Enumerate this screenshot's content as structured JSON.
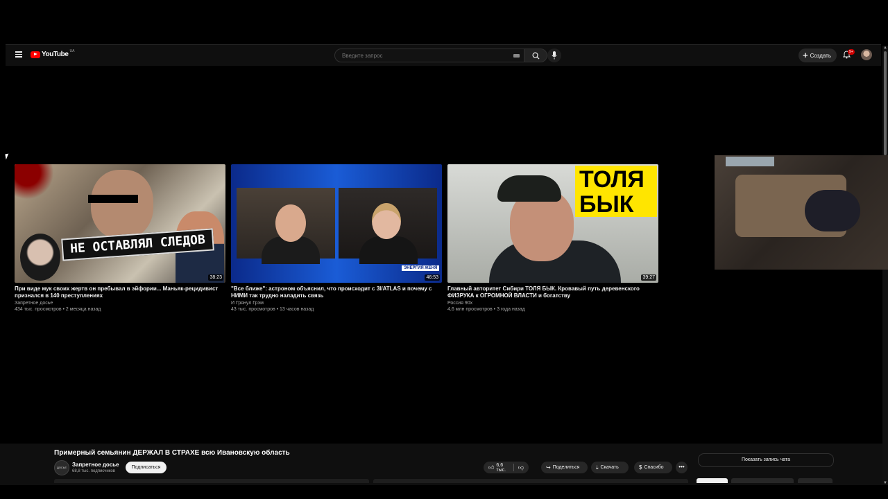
{
  "header": {
    "logo_text": "YouTube",
    "logo_sup": "UA",
    "search_placeholder": "Введите запрос",
    "create_label": "Создать",
    "notification_count": "9+"
  },
  "videos": [
    {
      "title": "При виде мук своих жертв он пребывал в эйфории... Маньяк-рецидивист признался в 140 преступлениях",
      "channel": "Запретное досье",
      "meta": "434 тыс. просмотров • 2 месяца назад",
      "duration": "38:23",
      "thumb_caption": "НЕ ОСТАВЛЯЛ СЛЕДОВ"
    },
    {
      "title": "\"Все ближе\": астроном объяснил, что происходит с 3I/ATLAS и почему с НИМИ так трудно наладить связь",
      "channel": "И Грянул Грэм",
      "meta": "43 тыс. просмотров • 13 часов назад",
      "duration": "46:53",
      "thumb_caption": "ЭНЕРГИЯ ЖЕНЯ"
    },
    {
      "title": "Главный авторитет Сибири ТОЛЯ БЫК. Кровавый путь деревенского ФИЗРУКА к ОГРОМНОЙ ВЛАСТИ и богатству",
      "channel": "Россия 90х",
      "meta": "4,6 млн просмотров • 3 года назад",
      "duration": "39:27",
      "thumb_caption": "ТОЛЯ БЫК"
    }
  ],
  "player": {
    "title": "Примерный семьянин ДЕРЖАЛ В СТРАХЕ всю Ивановскую область",
    "channel_name": "Запретное досье",
    "channel_avatar_text": "ДОСЬЕ",
    "subscribers": "68,8 тыс. подписчиков",
    "subscribe_label": "Подписаться",
    "likes": "6,6 тыс.",
    "share_label": "Поделиться",
    "download_label": "Скачать",
    "thanks_label": "Спасибо",
    "chat_replay_label": "Показать запись чата"
  }
}
